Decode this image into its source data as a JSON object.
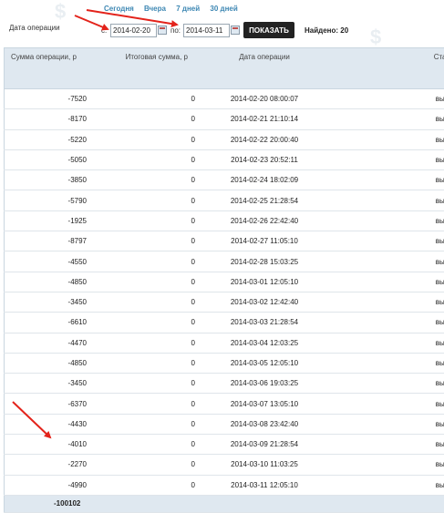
{
  "quick_links": [
    "Сегодня",
    "Вчера",
    "7 дней",
    "30 дней"
  ],
  "filter": {
    "label": "Дата операции",
    "from_label": "с:",
    "from_value": "2014-02-20",
    "to_label": "по:",
    "to_value": "2014-03-11",
    "show_button": "ПОКАЗАТЬ",
    "found": "Найдено: 20"
  },
  "table": {
    "headers": [
      "Сумма операции, р",
      "Итоговая сумма, р",
      "Дата операции",
      "Статус"
    ],
    "rows": [
      [
        "-7520",
        "0",
        "2014-02-20 08:00:07",
        "выплата"
      ],
      [
        "-8170",
        "0",
        "2014-02-21 21:10:14",
        "выплата"
      ],
      [
        "-5220",
        "0",
        "2014-02-22 20:00:40",
        "выплата"
      ],
      [
        "-5050",
        "0",
        "2014-02-23 20:52:11",
        "выплата"
      ],
      [
        "-3850",
        "0",
        "2014-02-24 18:02:09",
        "выплата"
      ],
      [
        "-5790",
        "0",
        "2014-02-25 21:28:54",
        "выплата"
      ],
      [
        "-1925",
        "0",
        "2014-02-26 22:42:40",
        "выплата"
      ],
      [
        "-8797",
        "0",
        "2014-02-27 11:05:10",
        "выплата"
      ],
      [
        "-4550",
        "0",
        "2014-02-28 15:03:25",
        "выплата"
      ],
      [
        "-4850",
        "0",
        "2014-03-01 12:05:10",
        "выплата"
      ],
      [
        "-3450",
        "0",
        "2014-03-02 12:42:40",
        "выплата"
      ],
      [
        "-6610",
        "0",
        "2014-03-03 21:28:54",
        "выплата"
      ],
      [
        "-4470",
        "0",
        "2014-03-04 12:03:25",
        "выплата"
      ],
      [
        "-4850",
        "0",
        "2014-03-05 12:05:10",
        "выплата"
      ],
      [
        "-3450",
        "0",
        "2014-03-06 19:03:25",
        "выплата"
      ],
      [
        "-6370",
        "0",
        "2014-03-07 13:05:10",
        "выплата"
      ],
      [
        "-4430",
        "0",
        "2014-03-08 23:42:40",
        "выплата"
      ],
      [
        "-4010",
        "0",
        "2014-03-09 21:28:54",
        "выплата"
      ],
      [
        "-2270",
        "0",
        "2014-03-10 11:03:25",
        "выплата"
      ],
      [
        "-4990",
        "0",
        "2014-03-11 12:05:10",
        "выплата"
      ]
    ],
    "total": "-100102"
  },
  "colors": {
    "annotation_arrow": "#e3231b",
    "link": "#3d87b3",
    "header_bg": "#dfe8f0"
  }
}
